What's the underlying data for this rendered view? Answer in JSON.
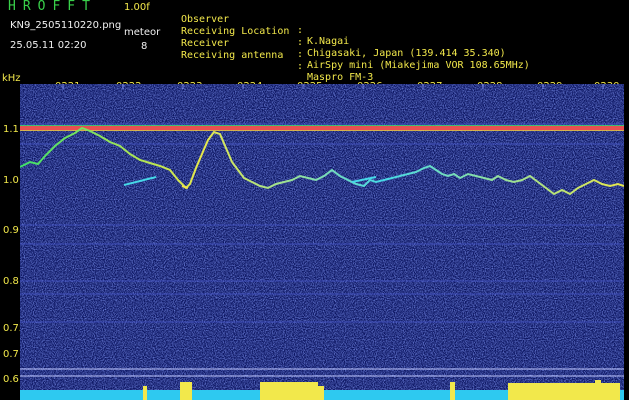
{
  "header": {
    "app_title": "HROFFT",
    "version": "1.00f",
    "filename": "KN9_2505110220.png",
    "meteor_label": "meteor",
    "datetime": "25.05.11 02:20",
    "meteor_count": "8"
  },
  "metadata": [
    {
      "key": "Observer",
      "value": "K.Nagai"
    },
    {
      "key": "Receiving Location",
      "value": "Chigasaki, Japan (139.414 35.340)"
    },
    {
      "key": "Receiver",
      "value": "AirSpy mini (Miakejima VOR 108.65MHz)"
    },
    {
      "key": "Receiving antenna",
      "value": "Maspro FM-3"
    }
  ],
  "axis": {
    "y_unit": "kHz",
    "y_ticks": [
      "1.1",
      "1.0",
      "0.9",
      "0.8",
      "0.75",
      "0.7",
      "0.6"
    ],
    "x_ticks": [
      "0221",
      "0222",
      "0223",
      "0224",
      "0225",
      "0226",
      "0227",
      "0228",
      "0229",
      "0230"
    ]
  },
  "colors": {
    "background": "#000000",
    "noise": "#1a2a9a",
    "label": "#f2e84b",
    "title": "#39d04a",
    "carrier": "#d83a3a",
    "signal_bar": "#2ec9f0",
    "signal_bar_peak": "#f2e84b"
  }
}
